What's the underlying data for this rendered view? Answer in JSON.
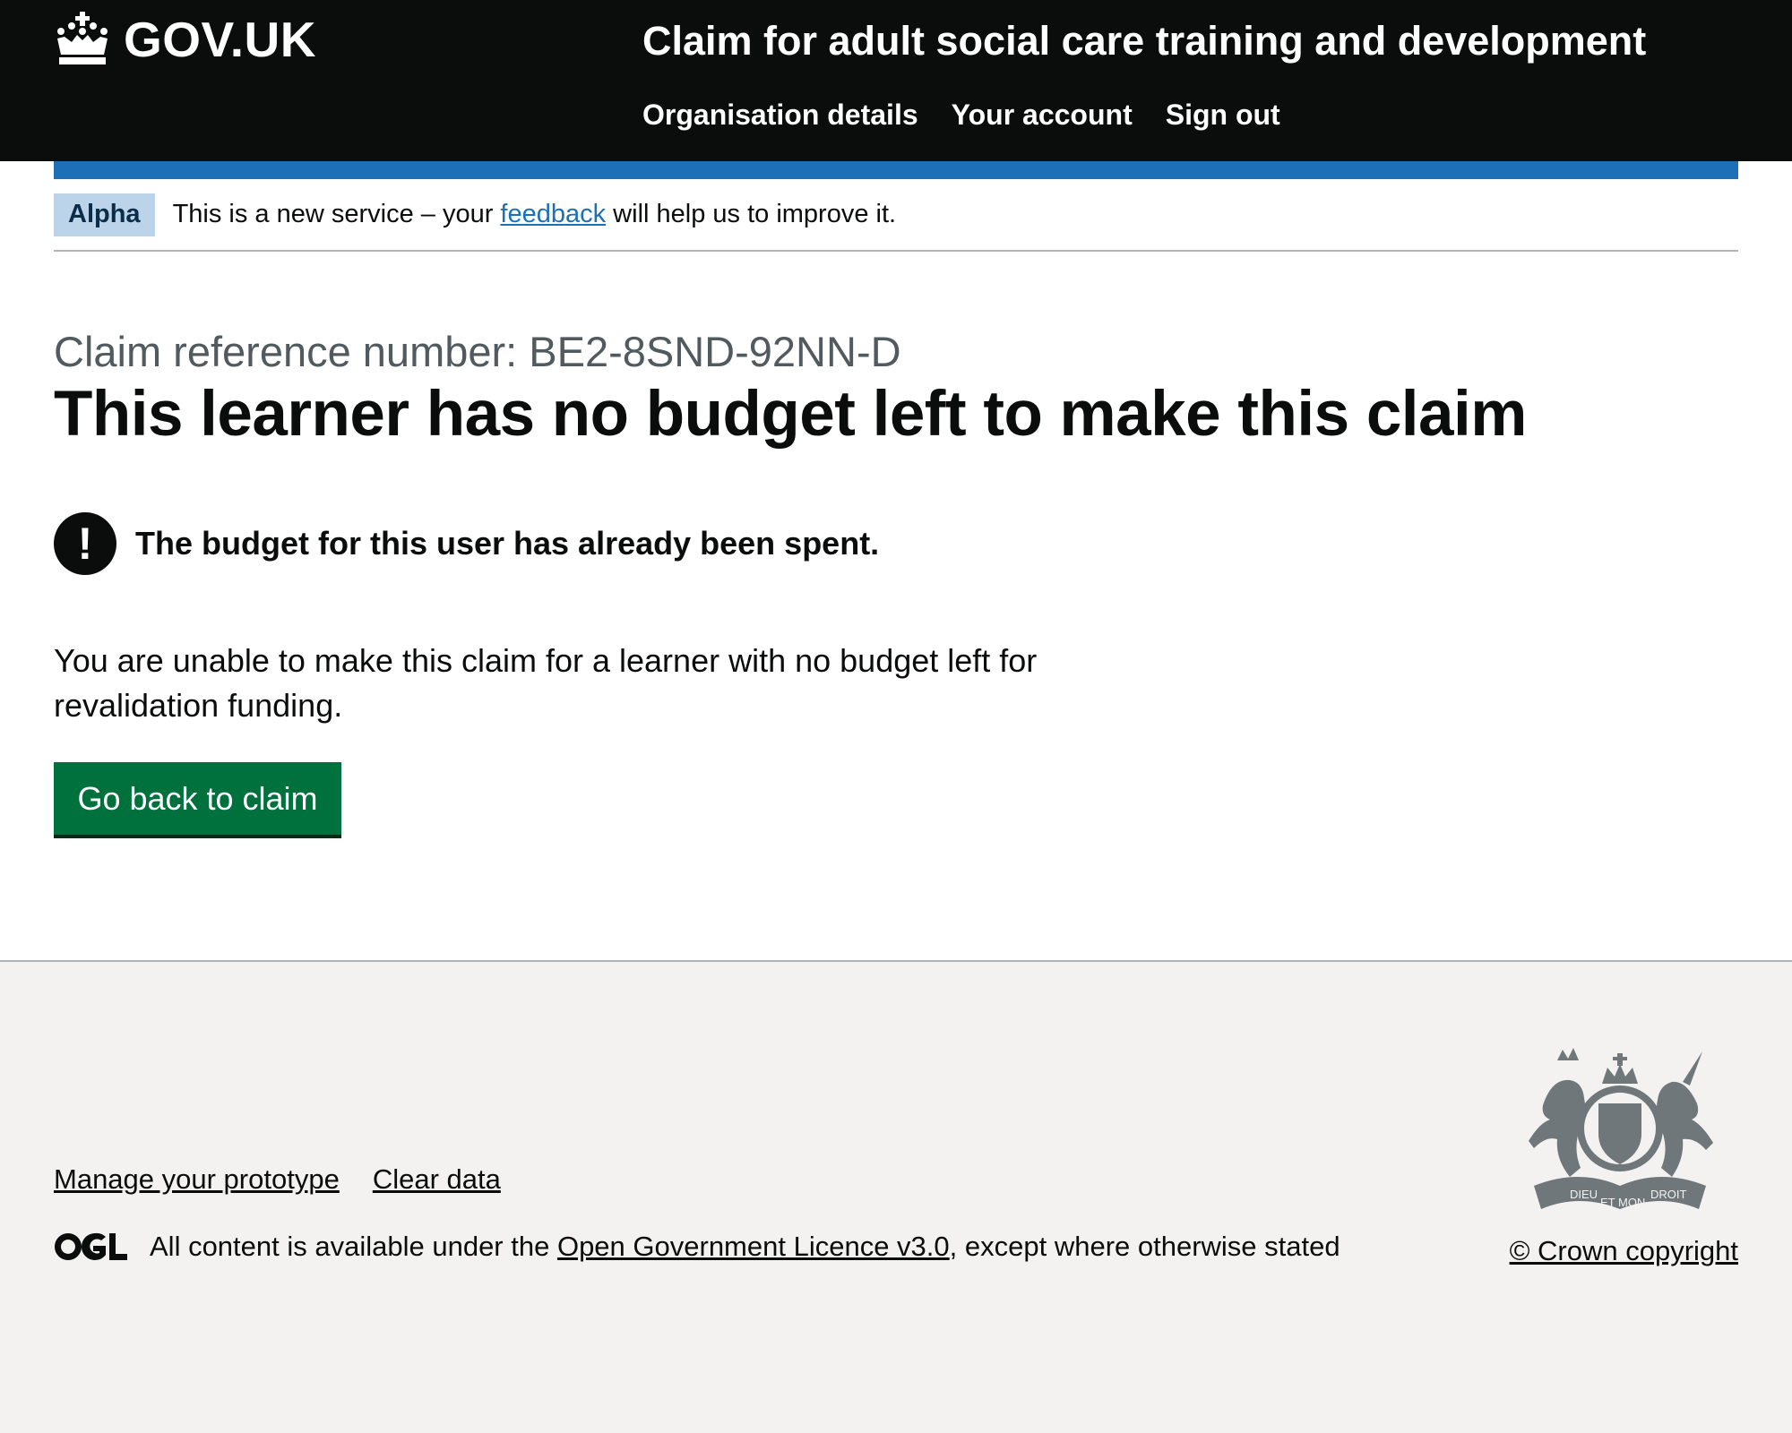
{
  "header": {
    "logo_text": "GOV.UK",
    "service_name": "Claim for adult social care training and development",
    "nav": [
      {
        "label": "Organisation details"
      },
      {
        "label": "Your account"
      },
      {
        "label": "Sign out"
      }
    ]
  },
  "phase_banner": {
    "tag": "Alpha",
    "text_before": "This is a new service – your ",
    "link": "feedback",
    "text_after": " will help us to improve it."
  },
  "main": {
    "caption": "Claim reference number: BE2-8SND-92NN-D",
    "heading": "This learner has no budget left to make this claim",
    "warning_icon": "!",
    "warning_text": "The budget for this user has already been spent.",
    "body": "You are unable to make this claim for a learner with no budget left for revalidation funding.",
    "button_label": "Go back to claim"
  },
  "footer": {
    "links": [
      {
        "label": "Manage your prototype"
      },
      {
        "label": "Clear data"
      }
    ],
    "licence_before": "All content is available under the ",
    "licence_link": "Open Government Licence v3.0",
    "licence_after": ", except where otherwise stated",
    "copyright": "© Crown copyright",
    "crest_motto_left": "DIEU",
    "crest_motto_center": "ET MON",
    "crest_motto_right": "DROIT"
  },
  "colors": {
    "header_bg": "#0b0c0c",
    "brand_blue": "#1d70b8",
    "button_green": "#00703c",
    "phase_tag_bg": "#bbd4ea",
    "footer_bg": "#f3f2f1"
  },
  "icons": [
    "crown-icon",
    "warning-icon",
    "ogl-logo",
    "royal-coat-of-arms"
  ]
}
